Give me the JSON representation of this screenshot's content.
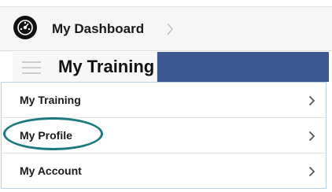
{
  "breadcrumb": {
    "logo_icon": "dashboard-logo-icon",
    "dashboard_label": "My Dashboard",
    "chevron_icon": "chevron-right-icon"
  },
  "header": {
    "menu_icon": "hamburger-menu-icon",
    "title": "My Training",
    "accent_color": "#3d5793"
  },
  "menu": {
    "items": [
      {
        "label": "My Training",
        "icon": "chevron-right-icon"
      },
      {
        "label": "My Profile",
        "icon": "chevron-right-icon",
        "highlighted": true
      },
      {
        "label": "My Account",
        "icon": "chevron-right-icon"
      }
    ],
    "highlight_color": "#1b7a7f"
  }
}
